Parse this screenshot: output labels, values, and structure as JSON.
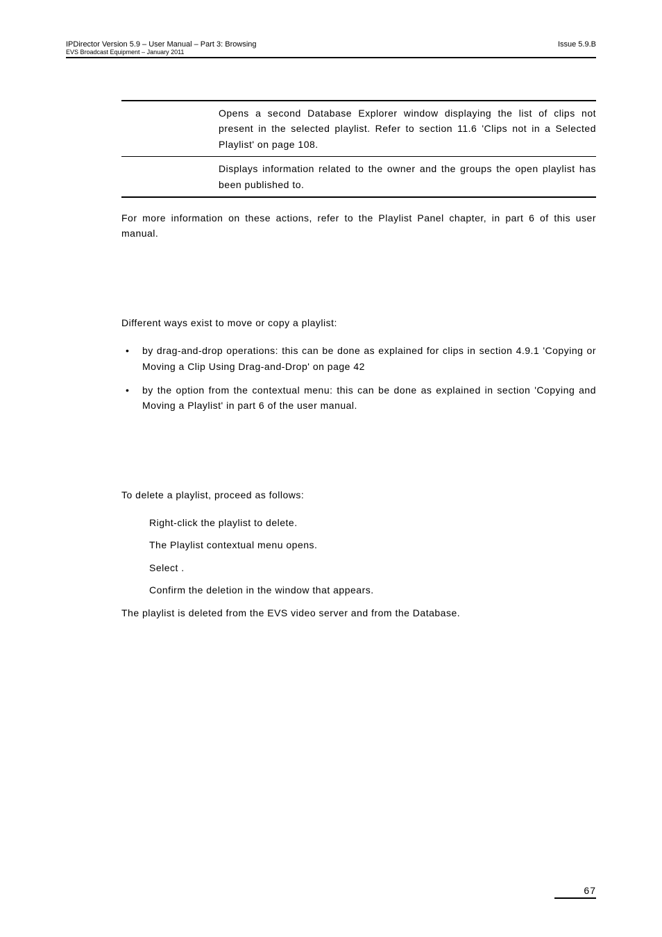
{
  "header": {
    "left_line1": "IPDirector Version 5.9 – User Manual – Part 3: Browsing",
    "left_line2": "EVS Broadcast Equipment – January 2011",
    "right": "Issue 5.9.B"
  },
  "table_rows": [
    "Opens a second Database Explorer window displaying the list of clips not present in the selected playlist. Refer to section 11.6 'Clips not in a Selected Playlist' on page 108.",
    "Displays information related to the owner and the groups the open playlist has been published to."
  ],
  "after_table": "For more information on these actions, refer to the Playlist Panel chapter, in part 6 of this user manual.",
  "section_copy": {
    "intro": "Different ways exist to move or copy a playlist:",
    "bullets": [
      "by drag-and-drop operations: this can be done as explained for clips in section 4.9.1 'Copying or Moving a Clip Using Drag-and-Drop' on page 42",
      "by the            option from the contextual menu: this can be done as explained in section 'Copying and Moving a Playlist' in part 6 of the user manual."
    ]
  },
  "section_delete": {
    "intro": "To delete a playlist, proceed as follows:",
    "steps": [
      "Right-click the playlist to delete.",
      "The Playlist contextual menu opens.",
      "Select                        .",
      "Confirm the deletion in the                              window that appears."
    ],
    "outro": "The playlist is deleted from the EVS video server and from the Database."
  },
  "footer": {
    "page": "67"
  }
}
